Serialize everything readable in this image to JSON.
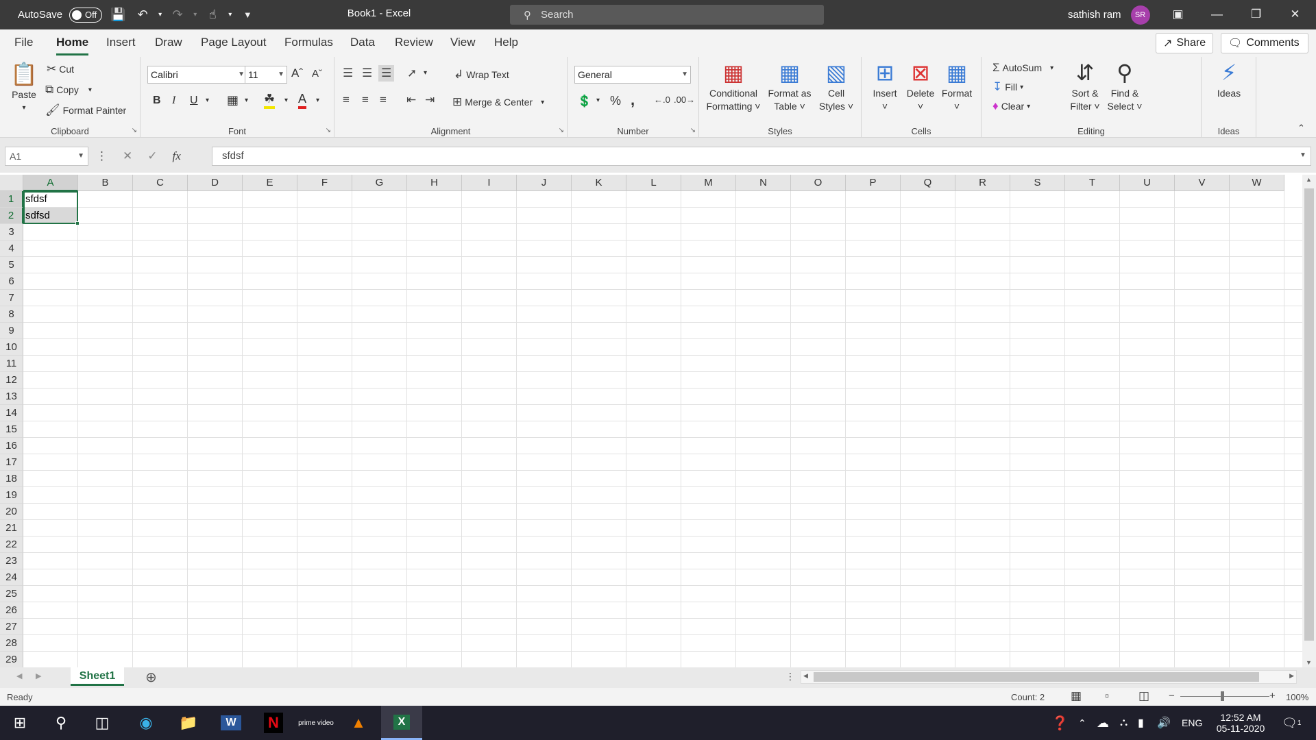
{
  "titlebar": {
    "autosave_label": "AutoSave",
    "autosave_state": "Off",
    "doc_title": "Book1  -  Excel",
    "search_placeholder": "Search",
    "user_name": "sathish ram",
    "user_initials": "SR"
  },
  "tabs": [
    "File",
    "Home",
    "Insert",
    "Draw",
    "Page Layout",
    "Formulas",
    "Data",
    "Review",
    "View",
    "Help"
  ],
  "active_tab": "Home",
  "share_label": "Share",
  "comments_label": "Comments",
  "ribbon": {
    "clipboard": {
      "label": "Clipboard",
      "paste": "Paste",
      "cut": "Cut",
      "copy": "Copy",
      "format_painter": "Format Painter"
    },
    "font": {
      "label": "Font",
      "font_name": "Calibri",
      "font_size": "11",
      "bold": "B",
      "italic": "I",
      "underline": "U"
    },
    "alignment": {
      "label": "Alignment",
      "wrap_text": "Wrap Text",
      "merge_center": "Merge & Center"
    },
    "number": {
      "label": "Number",
      "format": "General",
      "percent": "%",
      "comma": ","
    },
    "styles": {
      "label": "Styles",
      "conditional": "Conditional",
      "formatting": "Formatting",
      "format_as": "Format as",
      "table": "Table",
      "cell": "Cell",
      "styles_l": "Styles"
    },
    "cells": {
      "label": "Cells",
      "insert": "Insert",
      "delete": "Delete",
      "format": "Format"
    },
    "editing": {
      "label": "Editing",
      "autosum": "AutoSum",
      "fill": "Fill",
      "clear": "Clear",
      "sort": "Sort &",
      "filter": "Filter",
      "find": "Find &",
      "select": "Select"
    },
    "ideas": {
      "label": "Ideas",
      "ideas": "Ideas"
    }
  },
  "formula_bar": {
    "name_box": "A1",
    "fx": "fx",
    "formula": "sfdsf"
  },
  "columns": [
    "A",
    "B",
    "C",
    "D",
    "E",
    "F",
    "G",
    "H",
    "I",
    "J",
    "K",
    "L",
    "M",
    "N",
    "O",
    "P",
    "Q",
    "R",
    "S",
    "T",
    "U",
    "V",
    "W"
  ],
  "rows": [
    "1",
    "2",
    "3",
    "4",
    "5",
    "6",
    "7",
    "8",
    "9",
    "10",
    "11",
    "12",
    "13",
    "14",
    "15",
    "16",
    "17",
    "18",
    "19",
    "20",
    "21",
    "22",
    "23",
    "24",
    "25",
    "26",
    "27",
    "28",
    "29"
  ],
  "cells": {
    "A1": "sfdsf",
    "A2": "sdfsd"
  },
  "sheet": {
    "name": "Sheet1"
  },
  "status": {
    "ready": "Ready",
    "count": "Count: 2",
    "zoom": "100%"
  },
  "taskbar": {
    "lang": "ENG",
    "time": "12:52 AM",
    "date": "05-11-2020",
    "notif": "1",
    "prime": "prime video"
  }
}
